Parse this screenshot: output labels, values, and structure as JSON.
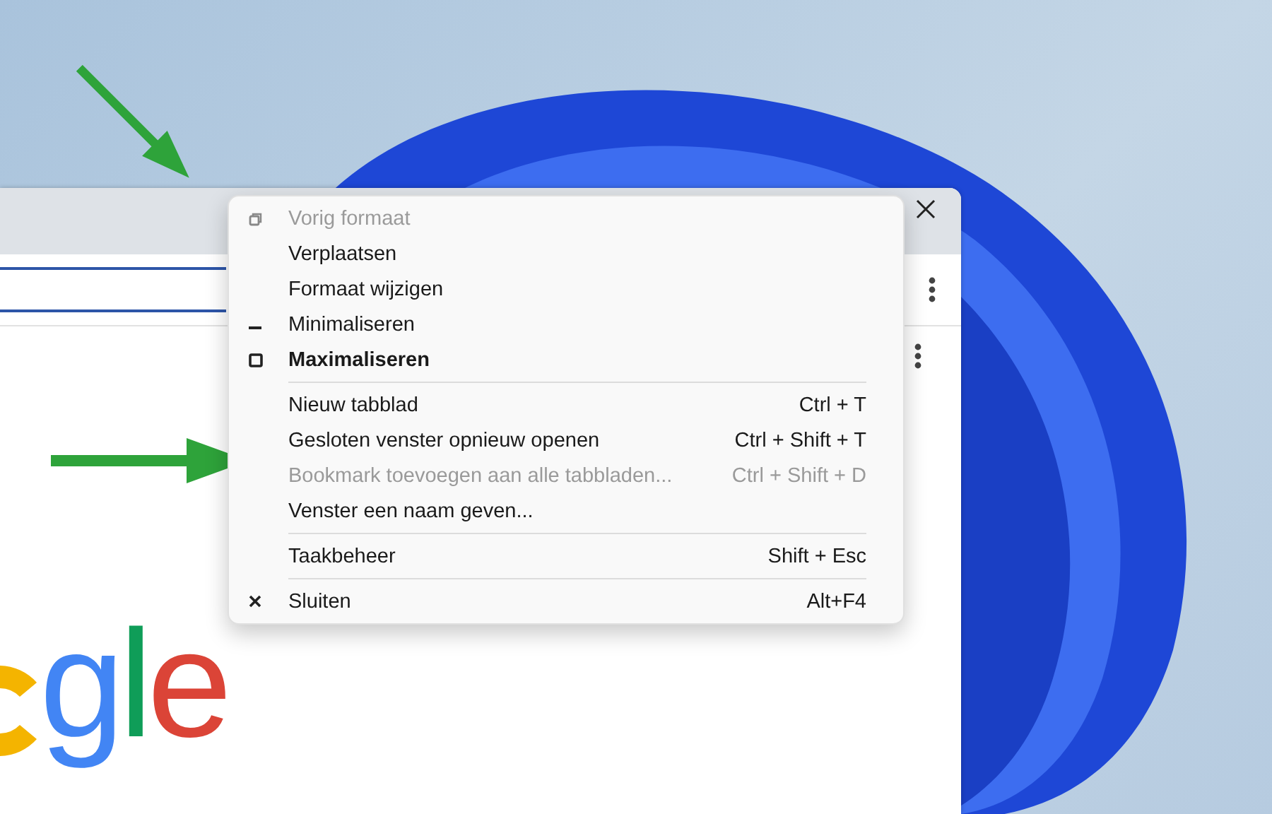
{
  "menu": {
    "groups": [
      {
        "items": [
          {
            "kind": "restore",
            "label": "Vorig formaat",
            "disabled": true,
            "bold": false
          },
          {
            "kind": "plain",
            "label": "Verplaatsen",
            "disabled": false,
            "bold": false
          },
          {
            "kind": "plain",
            "label": "Formaat wijzigen",
            "disabled": false,
            "bold": false
          },
          {
            "kind": "minimize",
            "label": "Minimaliseren",
            "disabled": false,
            "bold": false
          },
          {
            "kind": "maximize",
            "label": "Maximaliseren",
            "disabled": false,
            "bold": true
          }
        ]
      },
      {
        "items": [
          {
            "kind": "plain",
            "label": "Nieuw tabblad",
            "shortcut": "Ctrl + T",
            "disabled": false,
            "bold": false
          },
          {
            "kind": "plain",
            "label": "Gesloten venster opnieuw openen",
            "shortcut": "Ctrl + Shift + T",
            "disabled": false,
            "bold": false
          },
          {
            "kind": "plain",
            "label": "Bookmark toevoegen aan alle tabbladen...",
            "shortcut": "Ctrl + Shift + D",
            "disabled": true,
            "bold": false
          },
          {
            "kind": "plain",
            "label": "Venster een naam geven...",
            "disabled": false,
            "bold": false
          }
        ]
      },
      {
        "items": [
          {
            "kind": "plain",
            "label": "Taakbeheer",
            "shortcut": "Shift + Esc",
            "disabled": false,
            "bold": false
          }
        ]
      },
      {
        "items": [
          {
            "kind": "close",
            "label": "Sluiten",
            "shortcut": "Alt+F4",
            "disabled": false,
            "bold": false
          }
        ]
      }
    ]
  },
  "page": {
    "logo_text": "gle"
  }
}
